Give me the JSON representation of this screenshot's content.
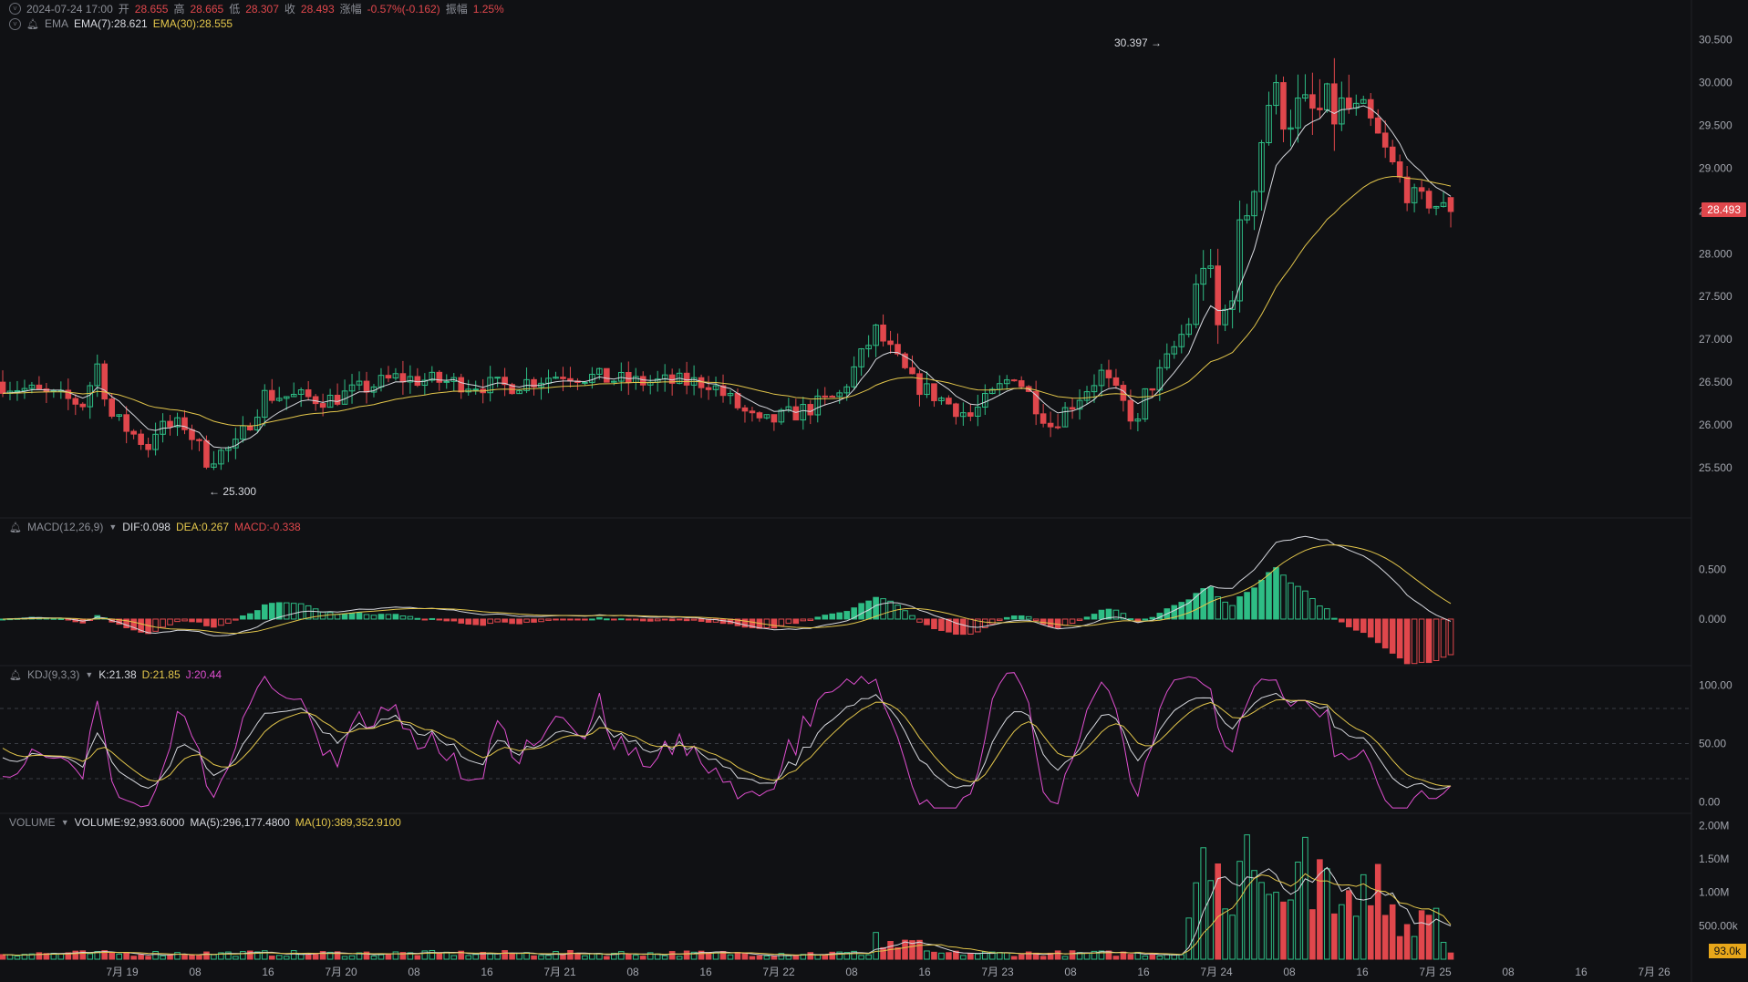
{
  "header": {
    "datetime": "2024-07-24 17:00",
    "open_label": "开",
    "open": "28.655",
    "high_label": "高",
    "high": "28.665",
    "low_label": "低",
    "low": "28.307",
    "close_label": "收",
    "close": "28.493",
    "change_label": "涨幅",
    "change": "-0.57%(-0.162)",
    "amp_label": "振幅",
    "amp": "1.25%"
  },
  "ema": {
    "name": "EMA",
    "ema7": "EMA(7):28.621",
    "ema30": "EMA(30):28.555"
  },
  "macd": {
    "name": "MACD(12,26,9)",
    "dif": "DIF:0.098",
    "dea": "DEA:0.267",
    "macd": "MACD:-0.338"
  },
  "kdj": {
    "name": "KDJ(9,3,3)",
    "k": "K:21.38",
    "d": "D:21.85",
    "j": "J:20.44"
  },
  "volume": {
    "name": "VOLUME",
    "vol": "VOLUME:92,993.6000",
    "ma5": "MA(5):296,177.4800",
    "ma10": "MA(10):389,352.9100"
  },
  "annotations": {
    "high": "30.397 →",
    "low": "← 25.300"
  },
  "last_price": "28.493",
  "last_volume": "93.0k",
  "colors": {
    "up": "#2ebd85",
    "down": "#e0474c",
    "bg": "#101114",
    "ema7": "#d6d8de",
    "ema30": "#e3c64b",
    "j": "#e04fd0"
  },
  "chart_data": [
    {
      "type": "candlestick",
      "title": "",
      "price_ticks": [
        "30.500",
        "30.000",
        "29.500",
        "29.000",
        "28.500",
        "28.000",
        "27.500",
        "27.000",
        "26.500",
        "26.000",
        "25.500"
      ],
      "time_ticks": [
        "7月 19",
        "08",
        "16",
        "7月 20",
        "08",
        "16",
        "7月 21",
        "08",
        "16",
        "7月 22",
        "08",
        "16",
        "7月 23",
        "08",
        "16",
        "7月 24",
        "08",
        "16",
        "7月 25",
        "08",
        "16",
        "7月 26"
      ],
      "ylim": [
        25.0,
        30.75
      ],
      "waypoints": [
        [
          0,
          26.5
        ],
        [
          12,
          26.25
        ],
        [
          14,
          26.7
        ],
        [
          16,
          26.1
        ],
        [
          21,
          25.75
        ],
        [
          22,
          25.95
        ],
        [
          26,
          26.0
        ],
        [
          29,
          25.6
        ],
        [
          33,
          25.75
        ],
        [
          37,
          26.35
        ],
        [
          46,
          26.3
        ],
        [
          55,
          26.55
        ],
        [
          70,
          26.45
        ],
        [
          78,
          26.6
        ],
        [
          88,
          26.5
        ],
        [
          98,
          26.5
        ],
        [
          105,
          26.0
        ],
        [
          112,
          26.2
        ],
        [
          116,
          26.35
        ],
        [
          121,
          27.1
        ],
        [
          126,
          26.5
        ],
        [
          134,
          26.1
        ],
        [
          140,
          26.6
        ],
        [
          145,
          26.0
        ],
        [
          152,
          26.6
        ],
        [
          157,
          26.0
        ],
        [
          158,
          26.35
        ],
        [
          160,
          26.6
        ],
        [
          164,
          27.2
        ],
        [
          166,
          28.0
        ],
        [
          168,
          27.1
        ],
        [
          169,
          27.3
        ],
        [
          175,
          29.8
        ],
        [
          180,
          29.6
        ],
        [
          188,
          29.7
        ],
        [
          194,
          28.7
        ],
        [
          200,
          28.5
        ]
      ],
      "last_candle": {
        "open": 28.655,
        "high": 28.665,
        "low": 28.307,
        "close": 28.493
      },
      "ema7": 28.621,
      "ema30": 28.555
    },
    {
      "type": "bar",
      "title": "",
      "ticks": [
        "0.500",
        "0.000"
      ],
      "dif": 0.098,
      "dea": 0.267,
      "macd": -0.338
    },
    {
      "type": "line",
      "title": "",
      "ticks": [
        "100.00",
        "50.00",
        "0.00"
      ],
      "k": 21.38,
      "d": 21.85,
      "j": 20.44
    },
    {
      "type": "bar",
      "title": "",
      "ticks": [
        "2.00M",
        "1.50M",
        "1.00M",
        "500.00k"
      ],
      "volume": 92993.6,
      "ma5": 296177.48,
      "ma10": 389352.91
    }
  ]
}
